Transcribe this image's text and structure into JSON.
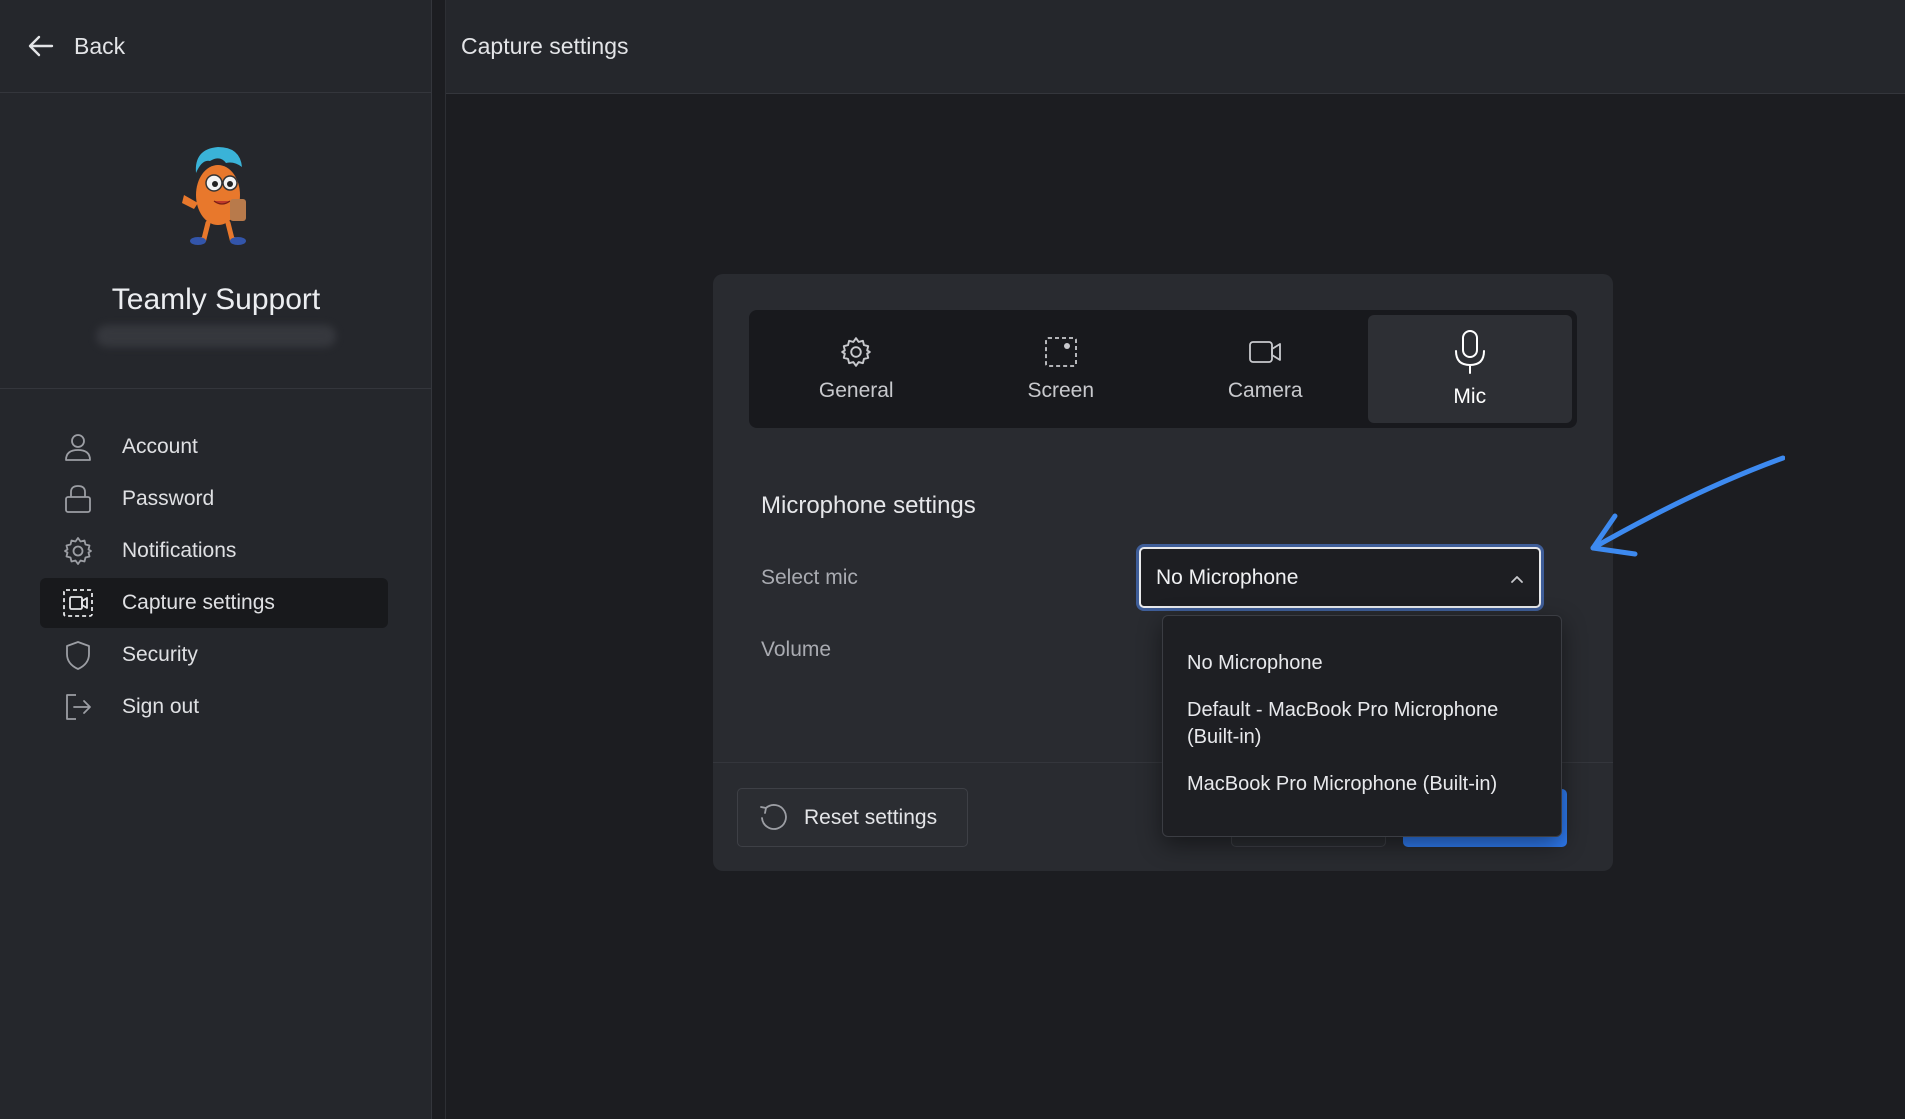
{
  "sidebar": {
    "back_label": "Back",
    "profile": {
      "name": "Teamly Support"
    },
    "items": [
      {
        "label": "Account",
        "icon": "user-icon"
      },
      {
        "label": "Password",
        "icon": "lock-icon"
      },
      {
        "label": "Notifications",
        "icon": "gear-icon"
      },
      {
        "label": "Capture settings",
        "icon": "capture-icon",
        "active": true
      },
      {
        "label": "Security",
        "icon": "shield-icon"
      },
      {
        "label": "Sign out",
        "icon": "sign-out-icon"
      }
    ]
  },
  "header": {
    "title": "Capture settings"
  },
  "dialog": {
    "tabs": [
      {
        "label": "General",
        "icon": "gear-icon"
      },
      {
        "label": "Screen",
        "icon": "screen-capture-icon"
      },
      {
        "label": "Camera",
        "icon": "camera-icon"
      },
      {
        "label": "Mic",
        "icon": "microphone-icon",
        "active": true
      }
    ],
    "section_title": "Microphone settings",
    "select_mic_label": "Select mic",
    "volume_label": "Volume",
    "selected_mic": "No Microphone",
    "options": [
      "No Microphone",
      "Default - MacBook Pro Microphone (Built-in)",
      "MacBook Pro Microphone (Built-in)"
    ],
    "reset_label": "Reset settings"
  },
  "colors": {
    "accent": "#2f7bf1",
    "annotation_arrow": "#3d8af0",
    "sidebar_bg": "#25272c",
    "main_bg": "#1c1d21"
  }
}
